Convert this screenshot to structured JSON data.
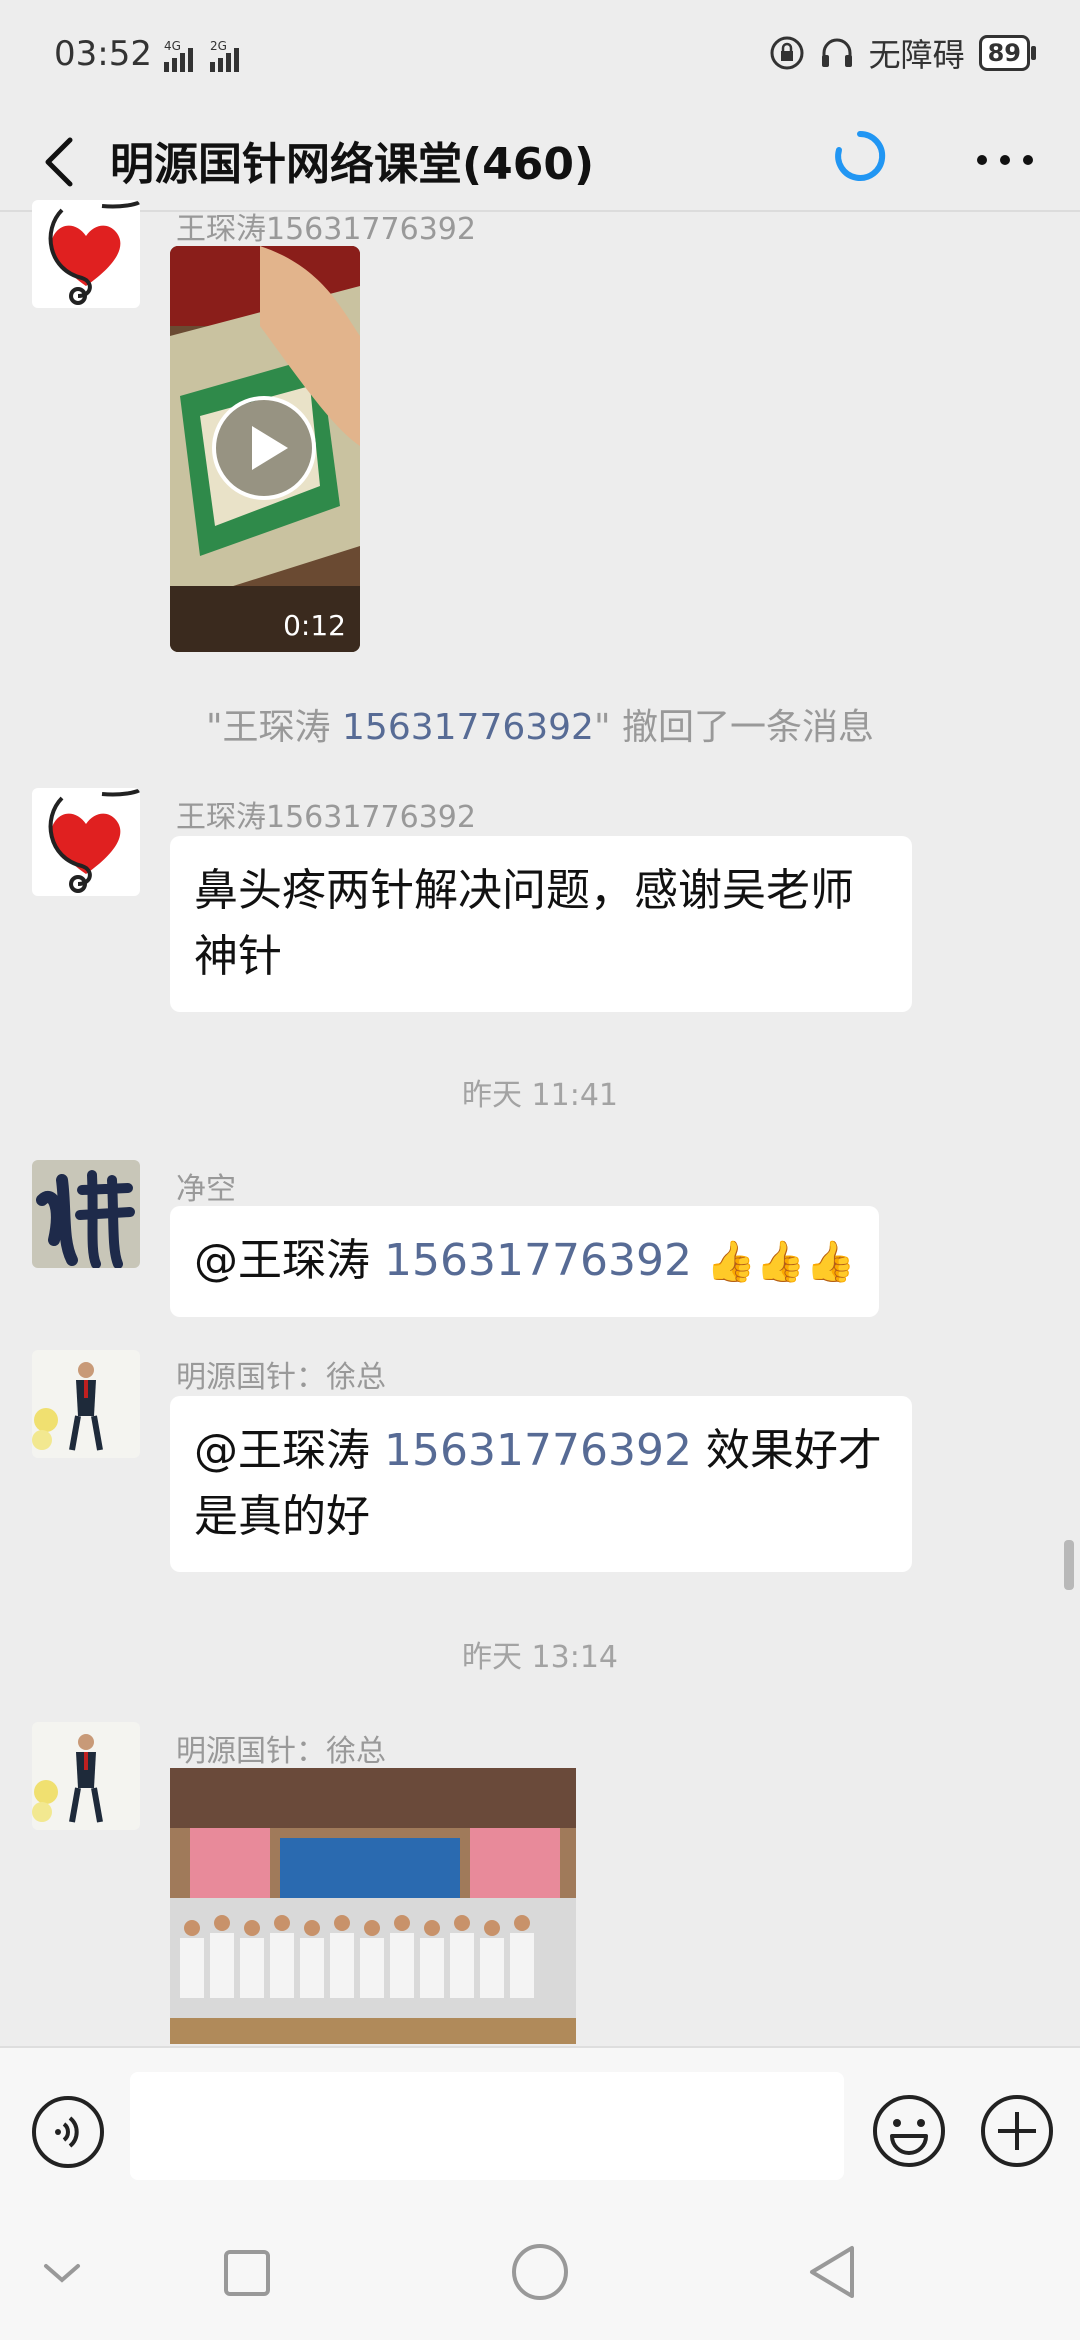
{
  "status_bar": {
    "time": "03:52",
    "network1": "4G",
    "network2": "2G",
    "accessibility": "无障碍",
    "battery": "89"
  },
  "header": {
    "title": "明源国针网络课堂(460)"
  },
  "messages": {
    "m1": {
      "sender": "王琛涛15631776392",
      "video_duration": "0:12"
    },
    "recall": {
      "prefix": "\"王琛涛 ",
      "number": "15631776392",
      "suffix": "\" 撤回了一条消息"
    },
    "m2": {
      "sender": "王琛涛15631776392",
      "text": "鼻头疼两针解决问题，感谢吴老师神针"
    },
    "time1": "昨天 11:41",
    "m3": {
      "sender": "净空",
      "at_name": "@王琛涛 ",
      "at_number": "15631776392",
      "emoji": "👍👍👍"
    },
    "m4": {
      "sender": "明源国针：徐总",
      "at_name": "@王琛涛 ",
      "at_number": "15631776392",
      "text": " 效果好才是真的好"
    },
    "time2": "昨天 13:14",
    "m5": {
      "sender": "明源国针：徐总"
    }
  },
  "input": {
    "placeholder": ""
  },
  "colors": {
    "link": "#576b95",
    "loading": "#2196f3",
    "bg": "#ededed"
  }
}
